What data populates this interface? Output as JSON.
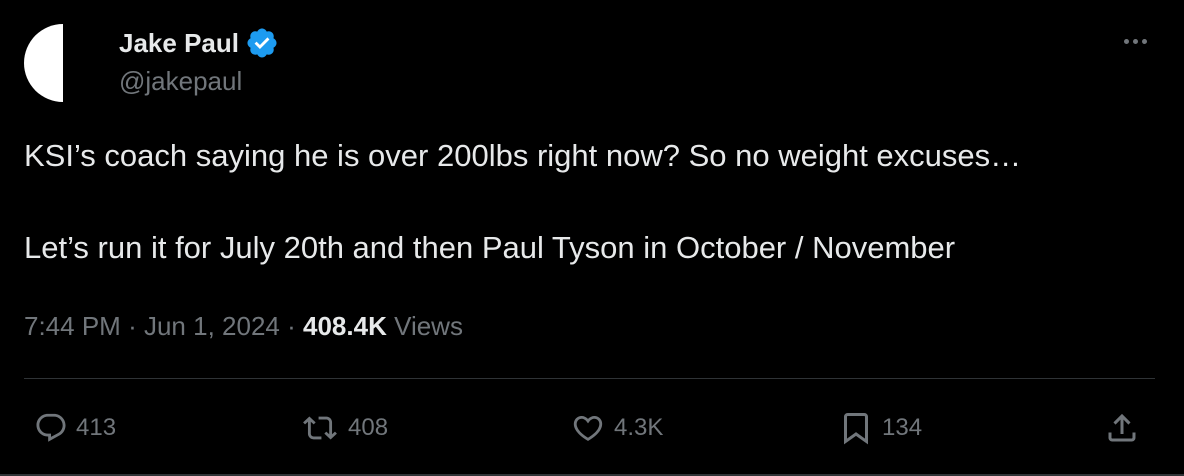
{
  "author": {
    "display_name": "Jake Paul",
    "handle": "@jakepaul",
    "verified": true,
    "verified_color": "#1d9bf0",
    "avatar_icon": "half-white-circle-avatar"
  },
  "tweet": {
    "line1": "KSI’s coach saying he is over 200lbs right now? So no weight excuses…",
    "line2": "Let’s run it for July 20th and then Paul Tyson in October / November"
  },
  "meta": {
    "time": "7:44 PM",
    "separator": "·",
    "date": "Jun 1, 2024",
    "views_count": "408.4K",
    "views_label": "Views"
  },
  "actions": {
    "replies": "413",
    "reposts": "408",
    "likes": "4.3K",
    "bookmarks": "134"
  },
  "icons": {
    "more": "more-icon",
    "reply": "reply-icon",
    "repost": "repost-icon",
    "like": "heart-icon",
    "bookmark": "bookmark-icon",
    "share": "share-icon"
  },
  "colors": {
    "background": "#000000",
    "primary_text": "#e7e9ea",
    "secondary_text": "#71767b",
    "divider": "#2f3336"
  }
}
